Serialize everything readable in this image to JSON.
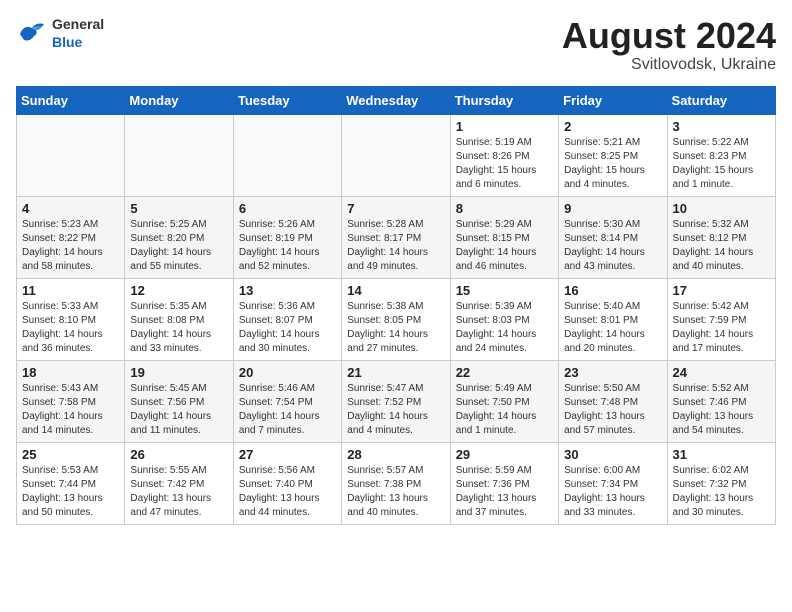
{
  "header": {
    "logo": {
      "general": "General",
      "blue": "Blue"
    },
    "title": "August 2024",
    "subtitle": "Svitlovodsk, Ukraine"
  },
  "weekdays": [
    "Sunday",
    "Monday",
    "Tuesday",
    "Wednesday",
    "Thursday",
    "Friday",
    "Saturday"
  ],
  "weeks": [
    [
      {
        "day": "",
        "info": ""
      },
      {
        "day": "",
        "info": ""
      },
      {
        "day": "",
        "info": ""
      },
      {
        "day": "",
        "info": ""
      },
      {
        "day": "1",
        "info": "Sunrise: 5:19 AM\nSunset: 8:26 PM\nDaylight: 15 hours\nand 6 minutes."
      },
      {
        "day": "2",
        "info": "Sunrise: 5:21 AM\nSunset: 8:25 PM\nDaylight: 15 hours\nand 4 minutes."
      },
      {
        "day": "3",
        "info": "Sunrise: 5:22 AM\nSunset: 8:23 PM\nDaylight: 15 hours\nand 1 minute."
      }
    ],
    [
      {
        "day": "4",
        "info": "Sunrise: 5:23 AM\nSunset: 8:22 PM\nDaylight: 14 hours\nand 58 minutes."
      },
      {
        "day": "5",
        "info": "Sunrise: 5:25 AM\nSunset: 8:20 PM\nDaylight: 14 hours\nand 55 minutes."
      },
      {
        "day": "6",
        "info": "Sunrise: 5:26 AM\nSunset: 8:19 PM\nDaylight: 14 hours\nand 52 minutes."
      },
      {
        "day": "7",
        "info": "Sunrise: 5:28 AM\nSunset: 8:17 PM\nDaylight: 14 hours\nand 49 minutes."
      },
      {
        "day": "8",
        "info": "Sunrise: 5:29 AM\nSunset: 8:15 PM\nDaylight: 14 hours\nand 46 minutes."
      },
      {
        "day": "9",
        "info": "Sunrise: 5:30 AM\nSunset: 8:14 PM\nDaylight: 14 hours\nand 43 minutes."
      },
      {
        "day": "10",
        "info": "Sunrise: 5:32 AM\nSunset: 8:12 PM\nDaylight: 14 hours\nand 40 minutes."
      }
    ],
    [
      {
        "day": "11",
        "info": "Sunrise: 5:33 AM\nSunset: 8:10 PM\nDaylight: 14 hours\nand 36 minutes."
      },
      {
        "day": "12",
        "info": "Sunrise: 5:35 AM\nSunset: 8:08 PM\nDaylight: 14 hours\nand 33 minutes."
      },
      {
        "day": "13",
        "info": "Sunrise: 5:36 AM\nSunset: 8:07 PM\nDaylight: 14 hours\nand 30 minutes."
      },
      {
        "day": "14",
        "info": "Sunrise: 5:38 AM\nSunset: 8:05 PM\nDaylight: 14 hours\nand 27 minutes."
      },
      {
        "day": "15",
        "info": "Sunrise: 5:39 AM\nSunset: 8:03 PM\nDaylight: 14 hours\nand 24 minutes."
      },
      {
        "day": "16",
        "info": "Sunrise: 5:40 AM\nSunset: 8:01 PM\nDaylight: 14 hours\nand 20 minutes."
      },
      {
        "day": "17",
        "info": "Sunrise: 5:42 AM\nSunset: 7:59 PM\nDaylight: 14 hours\nand 17 minutes."
      }
    ],
    [
      {
        "day": "18",
        "info": "Sunrise: 5:43 AM\nSunset: 7:58 PM\nDaylight: 14 hours\nand 14 minutes."
      },
      {
        "day": "19",
        "info": "Sunrise: 5:45 AM\nSunset: 7:56 PM\nDaylight: 14 hours\nand 11 minutes."
      },
      {
        "day": "20",
        "info": "Sunrise: 5:46 AM\nSunset: 7:54 PM\nDaylight: 14 hours\nand 7 minutes."
      },
      {
        "day": "21",
        "info": "Sunrise: 5:47 AM\nSunset: 7:52 PM\nDaylight: 14 hours\nand 4 minutes."
      },
      {
        "day": "22",
        "info": "Sunrise: 5:49 AM\nSunset: 7:50 PM\nDaylight: 14 hours\nand 1 minute."
      },
      {
        "day": "23",
        "info": "Sunrise: 5:50 AM\nSunset: 7:48 PM\nDaylight: 13 hours\nand 57 minutes."
      },
      {
        "day": "24",
        "info": "Sunrise: 5:52 AM\nSunset: 7:46 PM\nDaylight: 13 hours\nand 54 minutes."
      }
    ],
    [
      {
        "day": "25",
        "info": "Sunrise: 5:53 AM\nSunset: 7:44 PM\nDaylight: 13 hours\nand 50 minutes."
      },
      {
        "day": "26",
        "info": "Sunrise: 5:55 AM\nSunset: 7:42 PM\nDaylight: 13 hours\nand 47 minutes."
      },
      {
        "day": "27",
        "info": "Sunrise: 5:56 AM\nSunset: 7:40 PM\nDaylight: 13 hours\nand 44 minutes."
      },
      {
        "day": "28",
        "info": "Sunrise: 5:57 AM\nSunset: 7:38 PM\nDaylight: 13 hours\nand 40 minutes."
      },
      {
        "day": "29",
        "info": "Sunrise: 5:59 AM\nSunset: 7:36 PM\nDaylight: 13 hours\nand 37 minutes."
      },
      {
        "day": "30",
        "info": "Sunrise: 6:00 AM\nSunset: 7:34 PM\nDaylight: 13 hours\nand 33 minutes."
      },
      {
        "day": "31",
        "info": "Sunrise: 6:02 AM\nSunset: 7:32 PM\nDaylight: 13 hours\nand 30 minutes."
      }
    ]
  ]
}
